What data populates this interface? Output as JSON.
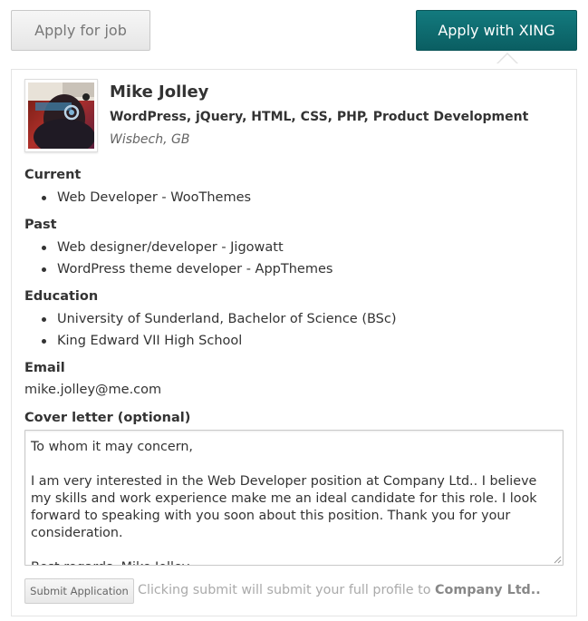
{
  "buttons": {
    "apply_label": "Apply for job",
    "xing_label": "Apply with XING",
    "submit_label": "Submit Application"
  },
  "profile": {
    "name": "Mike Jolley",
    "skills": "WordPress, jQuery, HTML, CSS, PHP, Product Development",
    "location": "Wisbech, GB",
    "avatar": "profile-photo"
  },
  "sections": {
    "current": {
      "heading": "Current",
      "items": [
        "Web Developer - WooThemes"
      ]
    },
    "past": {
      "heading": "Past",
      "items": [
        "Web designer/developer - Jigowatt",
        "WordPress theme developer - AppThemes"
      ]
    },
    "education": {
      "heading": "Education",
      "items": [
        "University of Sunderland, Bachelor of Science (BSc)",
        "King Edward VII High School"
      ]
    }
  },
  "email": {
    "heading": "Email",
    "value": "mike.jolley@me.com"
  },
  "cover_letter": {
    "label": "Cover letter (optional)",
    "value": "To whom it may concern,\n\nI am very interested in the Web Developer position at Company Ltd.. I believe my skills and work experience make me an ideal candidate for this role. I look forward to speaking with you soon about this position. Thank you for your consideration.\n\nBest regards, Mike Jolley"
  },
  "submit_note": {
    "text": "Clicking submit will submit your full profile to ",
    "company": "Company Ltd.."
  },
  "colors": {
    "xing_teal": "#0f6d72",
    "text": "#333333",
    "muted": "#aaaaaa"
  }
}
